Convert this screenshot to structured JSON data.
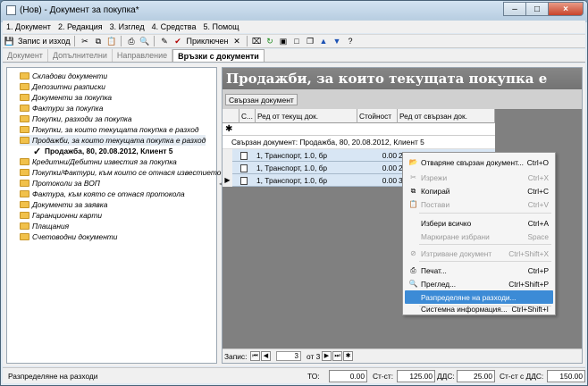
{
  "window": {
    "title": "(Нов) - Документ за покупка*",
    "buttons": {
      "minimize": "–",
      "maximize": "□",
      "close": "×"
    }
  },
  "menu": [
    {
      "label": "1. Документ"
    },
    {
      "label": "2. Редакция"
    },
    {
      "label": "3. Изглед"
    },
    {
      "label": "4. Средства"
    },
    {
      "label": "5. Помощ"
    }
  ],
  "toolbar": {
    "save_exit_label": "Запис и изход",
    "accept_label": "Приключен",
    "icons": [
      "save-icon",
      "cut-icon",
      "copy-icon",
      "paste-icon",
      "print-icon",
      "preview-icon",
      "edit-icon",
      "check-icon",
      "delete-icon",
      "refresh-icon",
      "move-up-icon",
      "move-down-icon",
      "help-icon"
    ]
  },
  "tabs": [
    {
      "label": "Документ",
      "active": false
    },
    {
      "label": "Допълнителни",
      "active": false
    },
    {
      "label": "Направление",
      "active": false
    },
    {
      "label": "Връзки с документи",
      "active": true
    }
  ],
  "tree": {
    "items": [
      {
        "label": "Складови документи"
      },
      {
        "label": "Депозитни разписки"
      },
      {
        "label": "Документи за покупка"
      },
      {
        "label": "Фактури за покупка"
      },
      {
        "label": "Покупки, разходи за покупка"
      },
      {
        "label": "Покупки, за които текущата покупка е разход"
      },
      {
        "label": "Продажби, за които текущата покупка е разход",
        "selected": true
      },
      {
        "label": "Продажба, 80, 20.08.2012, Клиент 5",
        "child": true
      },
      {
        "label": "Кредитни/Дебитни известия за покупка"
      },
      {
        "label": "Покупки/Фактури, към които се отнася известието"
      },
      {
        "label": "Протоколи за ВОП"
      },
      {
        "label": "Фактура, към която се отнася протокола"
      },
      {
        "label": "Документи за заявка"
      },
      {
        "label": "Гаранционни карти"
      },
      {
        "label": "Плащания"
      },
      {
        "label": "Счетоводни документи"
      }
    ]
  },
  "right": {
    "header": "Продажби, за които текущата покупка е разход",
    "group_chip": "Свързан документ",
    "columns": [
      "С...",
      "Ред от текущ док.",
      "Стойност",
      "Ред от свързан док."
    ],
    "group_row": "Свързан документ: Продажба, 80, 20.08.2012, Клиент 5",
    "rows": [
      {
        "line": "1, Транспорт, 1.0, бр",
        "value": "0.00"
      },
      {
        "line": "1, Транспорт, 1.0, бр",
        "value": "0.00"
      },
      {
        "line": "1, Транспорт, 1.0, бр",
        "value": "0.00"
      }
    ],
    "partial_text": [
      "2, ...",
      "2, ...",
      "3,"
    ]
  },
  "navigator": {
    "label": "Запис:",
    "current": "3",
    "of_label": "от 3"
  },
  "status": {
    "message": "Разпределяне на разходи",
    "to_label": "ТО:",
    "to_value": "0.00",
    "net_label": "Ст-ст:",
    "net_value": "125.00",
    "vat_label": "ДДС:",
    "vat_value": "25.00",
    "gross_label": "Ст-ст с ДДС:",
    "gross_value": "150.00"
  },
  "context_menu": [
    {
      "label": "Отваряне свързан документ...",
      "shortcut": "Ctrl+O",
      "icon": "folder-open-icon",
      "disabled": false
    },
    {
      "label": "Изрежи",
      "shortcut": "Ctrl+X",
      "icon": "cut-icon",
      "disabled": true
    },
    {
      "label": "Копирай",
      "shortcut": "Ctrl+C",
      "icon": "copy-icon",
      "disabled": false
    },
    {
      "label": "Постави",
      "shortcut": "Ctrl+V",
      "icon": "paste-icon",
      "disabled": true
    },
    {
      "label": "Избери всичко",
      "shortcut": "Ctrl+A",
      "icon": "",
      "disabled": false
    },
    {
      "label": "Маркиране избрани",
      "shortcut": "Space",
      "icon": "",
      "disabled": true
    },
    {
      "label": "Изтриване документ",
      "shortcut": "Ctrl+Shift+X",
      "icon": "delete-icon",
      "disabled": true
    },
    {
      "label": "Печат...",
      "shortcut": "Ctrl+P",
      "icon": "print-icon",
      "disabled": false
    },
    {
      "label": "Преглед...",
      "shortcut": "Ctrl+Shift+P",
      "icon": "preview-icon",
      "disabled": false
    },
    {
      "label": "Разпределяне на разходи...",
      "shortcut": "",
      "icon": "",
      "active": true
    },
    {
      "label": "Системна информация...",
      "shortcut": "Ctrl+Shift+I",
      "icon": "",
      "disabled": false
    }
  ]
}
